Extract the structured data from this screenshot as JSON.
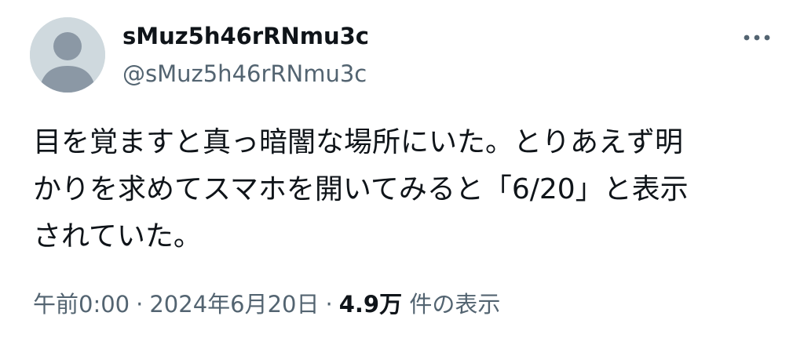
{
  "tweet": {
    "display_name": "sMuz5h46rRNmu3c",
    "handle": "@sMuz5h46rRNmu3c",
    "text_lines": [
      "目を覚ますと真っ暗闇な場所にいた。とりあえず明",
      "かりを求めてスマホを開いてみると「6/20」と表示",
      "されていた。"
    ],
    "time": "午前0:00",
    "separator": "·",
    "date": "2024年6月20日",
    "views_count": "4.9万",
    "views_label": "件の表示",
    "more_icon": "more-dots-icon",
    "avatar_icon": "default-avatar-icon"
  },
  "colors": {
    "text_primary": "#0f1419",
    "text_secondary": "#536471",
    "avatar_bg": "#cfd9de",
    "avatar_figure": "#8b98a5"
  }
}
